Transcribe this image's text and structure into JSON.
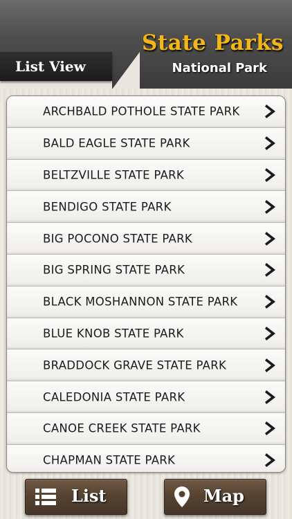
{
  "header": {
    "title": "State Parks",
    "subtitle": "National Park",
    "view_tab": "List View"
  },
  "parks": [
    "ARCHBALD POTHOLE STATE PARK",
    "BALD EAGLE STATE PARK",
    "BELTZVILLE STATE PARK",
    "BENDIGO STATE PARK",
    "BIG POCONO STATE PARK",
    "BIG SPRING STATE PARK",
    "BLACK MOSHANNON STATE PARK",
    "BLUE KNOB STATE PARK",
    "BRADDOCK GRAVE STATE PARK",
    "CALEDONIA STATE PARK",
    "CANOE CREEK STATE PARK",
    "CHAPMAN STATE PARK"
  ],
  "row_icon": "chevron-right-icon",
  "buttons": {
    "list_label": "List",
    "list_icon": "list-icon",
    "map_label": "Map",
    "map_icon": "map-pin-icon"
  },
  "colors": {
    "title": "#f2b616",
    "button": "#54412f",
    "header": "#4f4f4f"
  }
}
